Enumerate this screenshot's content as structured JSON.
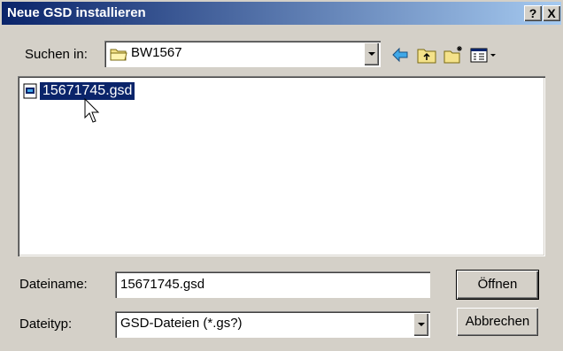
{
  "window": {
    "title": "Neue GSD installieren",
    "help": "?",
    "close": "X"
  },
  "look_in": {
    "label": "Suchen in:",
    "value": "BW1567",
    "icon": "folder-icon"
  },
  "toolbar": [
    "back-arrow-icon",
    "up-folder-icon",
    "new-folder-icon",
    "view-menu-icon"
  ],
  "files": [
    {
      "name": "15671745.gsd",
      "icon": "gsd-file-icon",
      "selected": true
    }
  ],
  "filename": {
    "label": "Dateiname:",
    "value": "15671745.gsd"
  },
  "filetype": {
    "label": "Dateityp:",
    "value": "GSD-Dateien (*.gs?)"
  },
  "buttons": {
    "open": "Öffnen",
    "cancel": "Abbrechen"
  },
  "colors": {
    "title_start": "#0a246a",
    "title_end": "#a6caf0",
    "face": "#d4d0c8",
    "selection": "#0a246a"
  }
}
